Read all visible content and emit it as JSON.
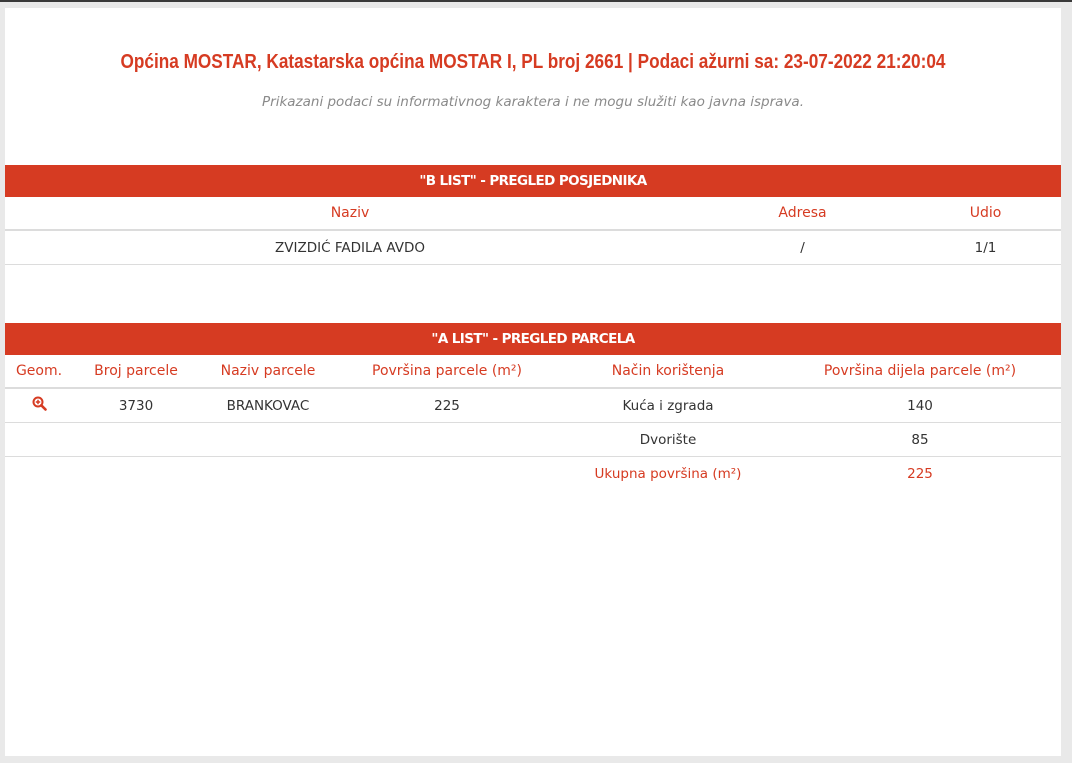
{
  "header": {
    "title": "Općina MOSTAR, Katastarska općina MOSTAR I, PL broj 2661 | Podaci ažurni sa: 23-07-2022 21:20:04",
    "subtitle": "Prikazani podaci su informativnog karaktera i ne mogu služiti kao javna isprava."
  },
  "b_list": {
    "title": "\"B LIST\" - PREGLED POSJEDNIKA",
    "columns": {
      "naziv": "Naziv",
      "adresa": "Adresa",
      "udio": "Udio"
    },
    "rows": [
      {
        "naziv": "ZVIZDIĆ FADILA AVDO",
        "adresa": "/",
        "udio": "1/1"
      }
    ]
  },
  "a_list": {
    "title": "\"A LIST\" - PREGLED PARCELA",
    "columns": {
      "geom": "Geom.",
      "broj_parcele": "Broj parcele",
      "naziv_parcele": "Naziv parcele",
      "povrsina_parcele": "Površina parcele (m²)",
      "nacin_koristenja": "Način korištenja",
      "povrsina_dijela": "Površina dijela parcele (m²)"
    },
    "rows": [
      {
        "geom_icon": "zoom-in-icon",
        "broj_parcele": "3730",
        "naziv_parcele": "BRANKOVAC",
        "povrsina_parcele": "225",
        "nacin_koristenja": "Kuća i zgrada",
        "povrsina_dijela": "140"
      },
      {
        "nacin_koristenja": "Dvorište",
        "povrsina_dijela": "85"
      }
    ],
    "total": {
      "label": "Ukupna površina (m²)",
      "value": "225"
    }
  },
  "colors": {
    "accent": "#d63b22",
    "text": "#333333",
    "muted": "#8a8a8a"
  }
}
